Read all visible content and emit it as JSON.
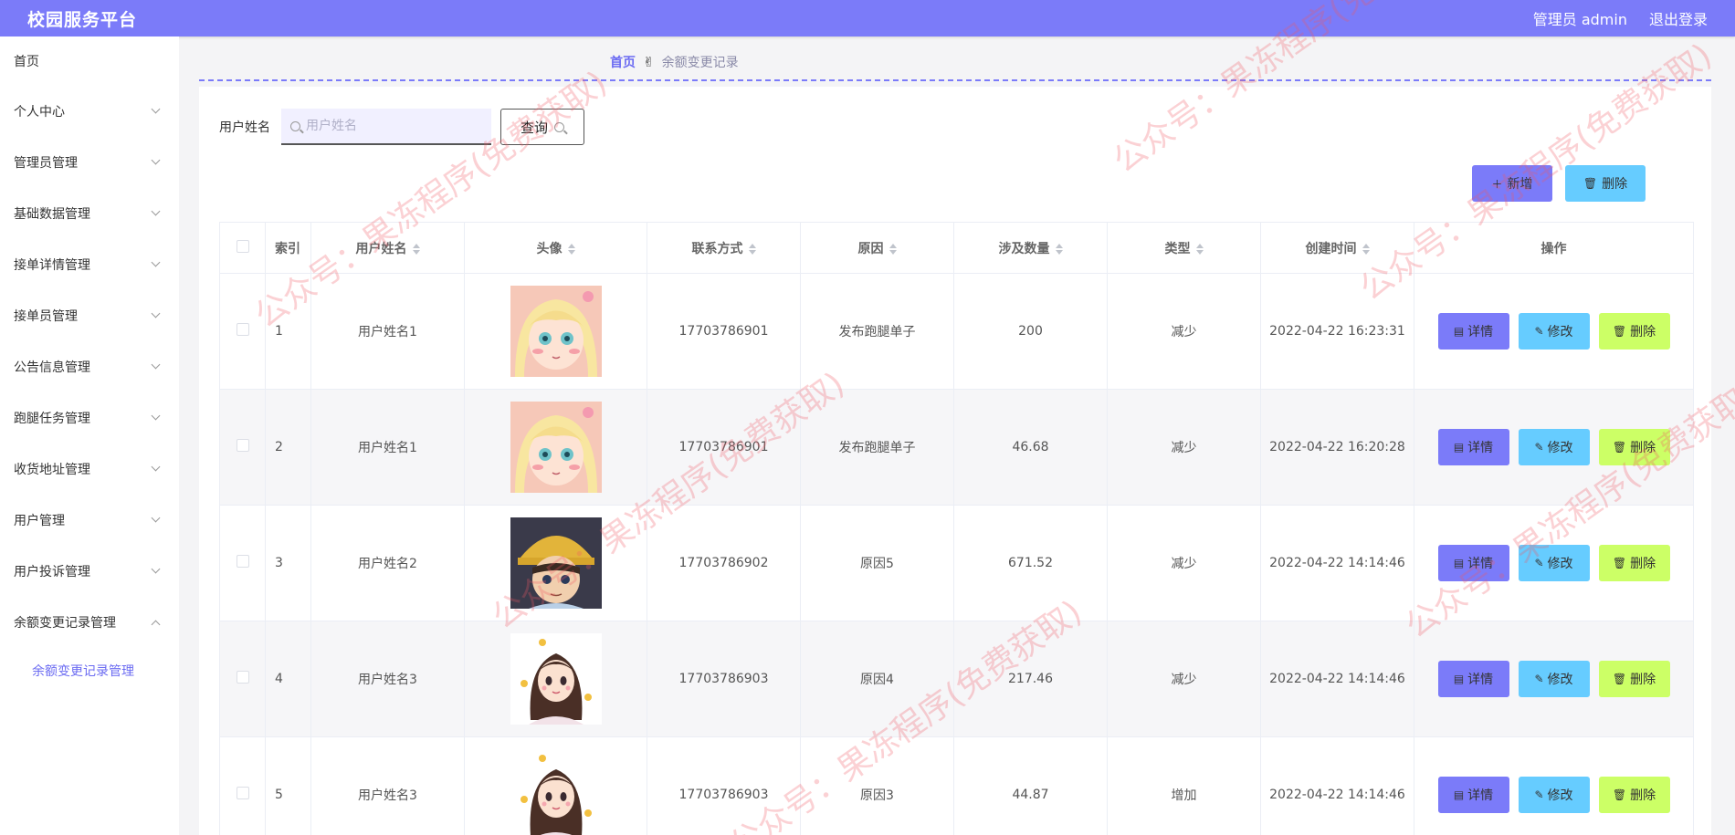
{
  "header": {
    "title": "校园服务平台",
    "user": "管理员 admin",
    "logout": "退出登录"
  },
  "sidebar": {
    "items": [
      {
        "label": "首页"
      },
      {
        "label": "个人中心"
      },
      {
        "label": "管理员管理"
      },
      {
        "label": "基础数据管理"
      },
      {
        "label": "接单详情管理"
      },
      {
        "label": "接单员管理"
      },
      {
        "label": "公告信息管理"
      },
      {
        "label": "跑腿任务管理"
      },
      {
        "label": "收货地址管理"
      },
      {
        "label": "用户管理"
      },
      {
        "label": "用户投诉管理"
      },
      {
        "label": "余额变更记录管理"
      }
    ],
    "sub_item": "余额变更记录管理"
  },
  "breadcrumb": {
    "home": "首页",
    "current": "余额变更记录"
  },
  "search": {
    "label": "用户姓名",
    "placeholder": "用户姓名",
    "button": "查询"
  },
  "actions": {
    "add": "新增",
    "delete": "删除"
  },
  "table": {
    "headers": [
      "索引",
      "用户姓名",
      "头像",
      "联系方式",
      "原因",
      "涉及数量",
      "类型",
      "创建时间",
      "操作"
    ],
    "row_actions": {
      "detail": "详情",
      "edit": "修改",
      "delete": "删除"
    },
    "rows": [
      {
        "index": "1",
        "name": "用户姓名1",
        "phone": "17703786901",
        "reason": "发布跑腿单子",
        "amount": "200",
        "type": "减少",
        "time": "2022-04-22 16:23:31"
      },
      {
        "index": "2",
        "name": "用户姓名1",
        "phone": "17703786901",
        "reason": "发布跑腿单子",
        "amount": "46.68",
        "type": "减少",
        "time": "2022-04-22 16:20:28"
      },
      {
        "index": "3",
        "name": "用户姓名2",
        "phone": "17703786902",
        "reason": "原因5",
        "amount": "671.52",
        "type": "减少",
        "time": "2022-04-22 14:14:46"
      },
      {
        "index": "4",
        "name": "用户姓名3",
        "phone": "17703786903",
        "reason": "原因4",
        "amount": "217.46",
        "type": "减少",
        "time": "2022-04-22 14:14:46"
      },
      {
        "index": "5",
        "name": "用户姓名3",
        "phone": "17703786903",
        "reason": "原因3",
        "amount": "44.87",
        "type": "增加",
        "time": "2022-04-22 14:14:46"
      }
    ]
  },
  "watermark": "公众号：果冻程序(免费获取)",
  "colors": {
    "primary": "#7b7bf9",
    "edit": "#66ccff",
    "delete": "#ccff66"
  }
}
